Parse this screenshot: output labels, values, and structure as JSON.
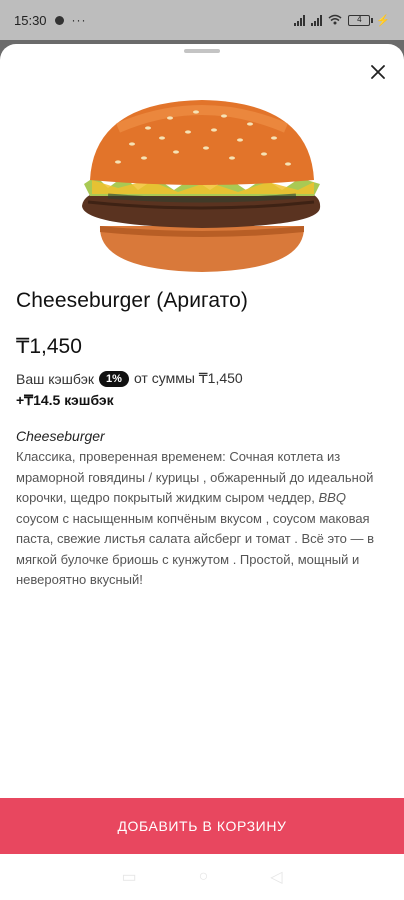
{
  "status": {
    "time": "15:30",
    "battery": "4"
  },
  "product": {
    "title": "Cheeseburger (Аригато)",
    "price": "₸1,450",
    "cashback_prefix": "Ваш кэшбэк",
    "cashback_badge": "1%",
    "cashback_suffix": "от суммы ₸1,450",
    "cashback_amount": "+₸14.5 кэшбэк",
    "description_title": "Cheeseburger",
    "description_part1": "Классика, проверенная временем: Сочная  котлета из мраморной говядины / курицы , обжаренный до идеальной корочки, щедро покрытый жидким сыром чеддер, ",
    "description_em": "BBQ",
    "description_part2": " соусом с насыщенным копчёным вкусом , соусом маковая паста, свежие листья салата айсберг и томат . Всё это — в мягкой булочке бриошь с кунжутом . Простой, мощный и невероятно вкусный!",
    "image_icon": "burger-image"
  },
  "actions": {
    "add_to_cart": "ДОБАВИТЬ В КОРЗИНУ"
  },
  "colors": {
    "accent": "#e8475f"
  }
}
